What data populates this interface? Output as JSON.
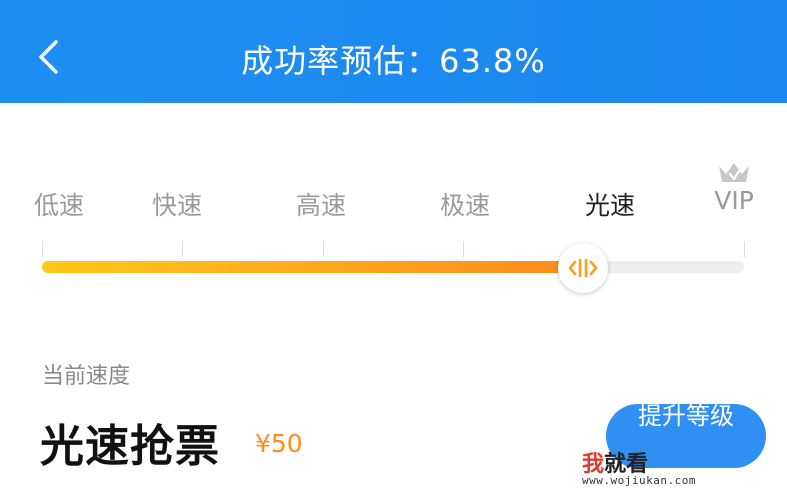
{
  "header": {
    "status_fragment": "",
    "title": "成功率预估：63.8%",
    "back_icon": "chevron-left-icon"
  },
  "speed_selector": {
    "options": [
      {
        "label": "低速"
      },
      {
        "label": "快速"
      },
      {
        "label": "高速"
      },
      {
        "label": "极速"
      },
      {
        "label": "光速"
      },
      {
        "label": "VIP"
      }
    ],
    "selected": "光速",
    "vip_icon": "crown-icon",
    "progress": 0.77,
    "colors": {
      "fill_start": "#ffc81a",
      "fill_end": "#ff8a1f",
      "track": "#eeeeee",
      "thumb_icon": "#ff9d1f"
    }
  },
  "current": {
    "label": "当前速度",
    "name": "光速抢票",
    "price": "¥50"
  },
  "upgrade_button": {
    "label": "提升等级"
  },
  "watermark": {
    "logo": "我就看",
    "logo_first": "我",
    "logo_rest": "就看",
    "url": "www.wojiukan.com"
  },
  "colors": {
    "header_bg": "#1f8ef1",
    "price": "#ff8c1a",
    "button_bg": "#2f8ff2"
  }
}
